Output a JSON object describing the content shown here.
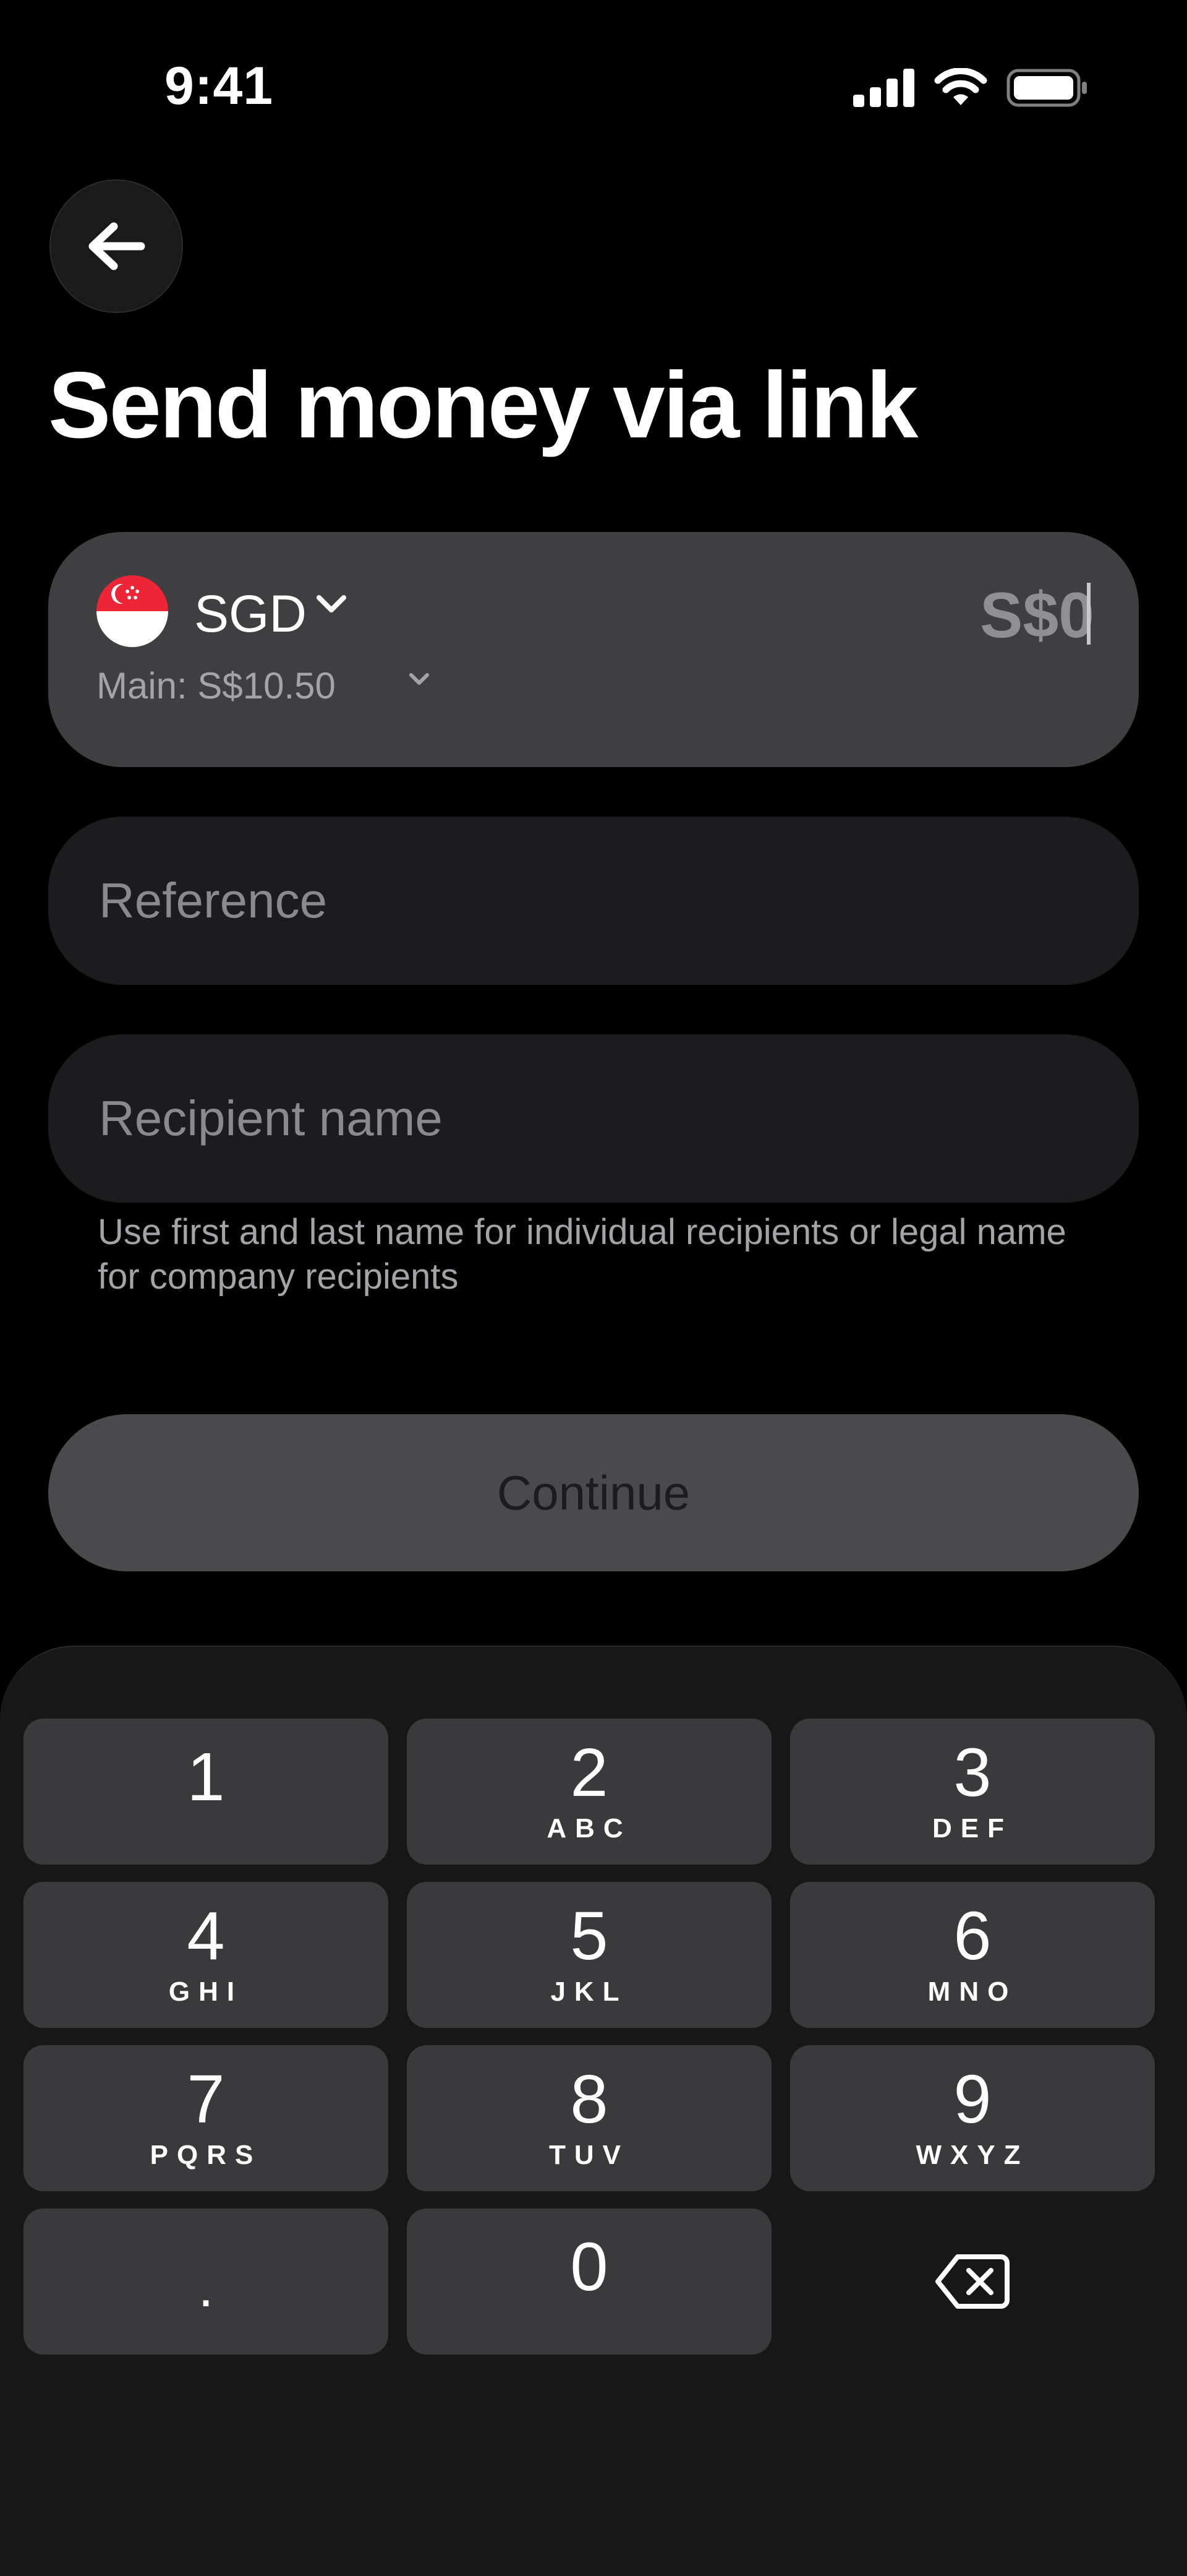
{
  "status_bar": {
    "time": "9:41"
  },
  "header": {
    "title": "Send money via link"
  },
  "amount_card": {
    "currency_code": "SGD",
    "amount": "S$0",
    "main_balance": "Main: S$10.50"
  },
  "reference_field": {
    "placeholder": "Reference",
    "value": ""
  },
  "recipient_field": {
    "placeholder": "Recipient name",
    "value": ""
  },
  "recipient_hint": "Use first and last name for individual recipients or legal name for company recipients",
  "continue_label": "Continue",
  "keypad": {
    "keys": [
      {
        "num": "1",
        "letters": ""
      },
      {
        "num": "2",
        "letters": "ABC"
      },
      {
        "num": "3",
        "letters": "DEF"
      },
      {
        "num": "4",
        "letters": "GHI"
      },
      {
        "num": "5",
        "letters": "JKL"
      },
      {
        "num": "6",
        "letters": "MNO"
      },
      {
        "num": "7",
        "letters": "PQRS"
      },
      {
        "num": "8",
        "letters": "TUV"
      },
      {
        "num": "9",
        "letters": "WXYZ"
      },
      {
        "num": ".",
        "letters": ""
      },
      {
        "num": "0",
        "letters": ""
      }
    ],
    "backspace_icon": "backspace-icon"
  },
  "colors": {
    "background": "#000000",
    "card": "#3f3f41",
    "field": "#1c1c1e",
    "button_disabled": "#4a4a4c",
    "keypad_bg": "#171717",
    "key": "#3a3a3c",
    "flag_red": "#ee2536"
  }
}
